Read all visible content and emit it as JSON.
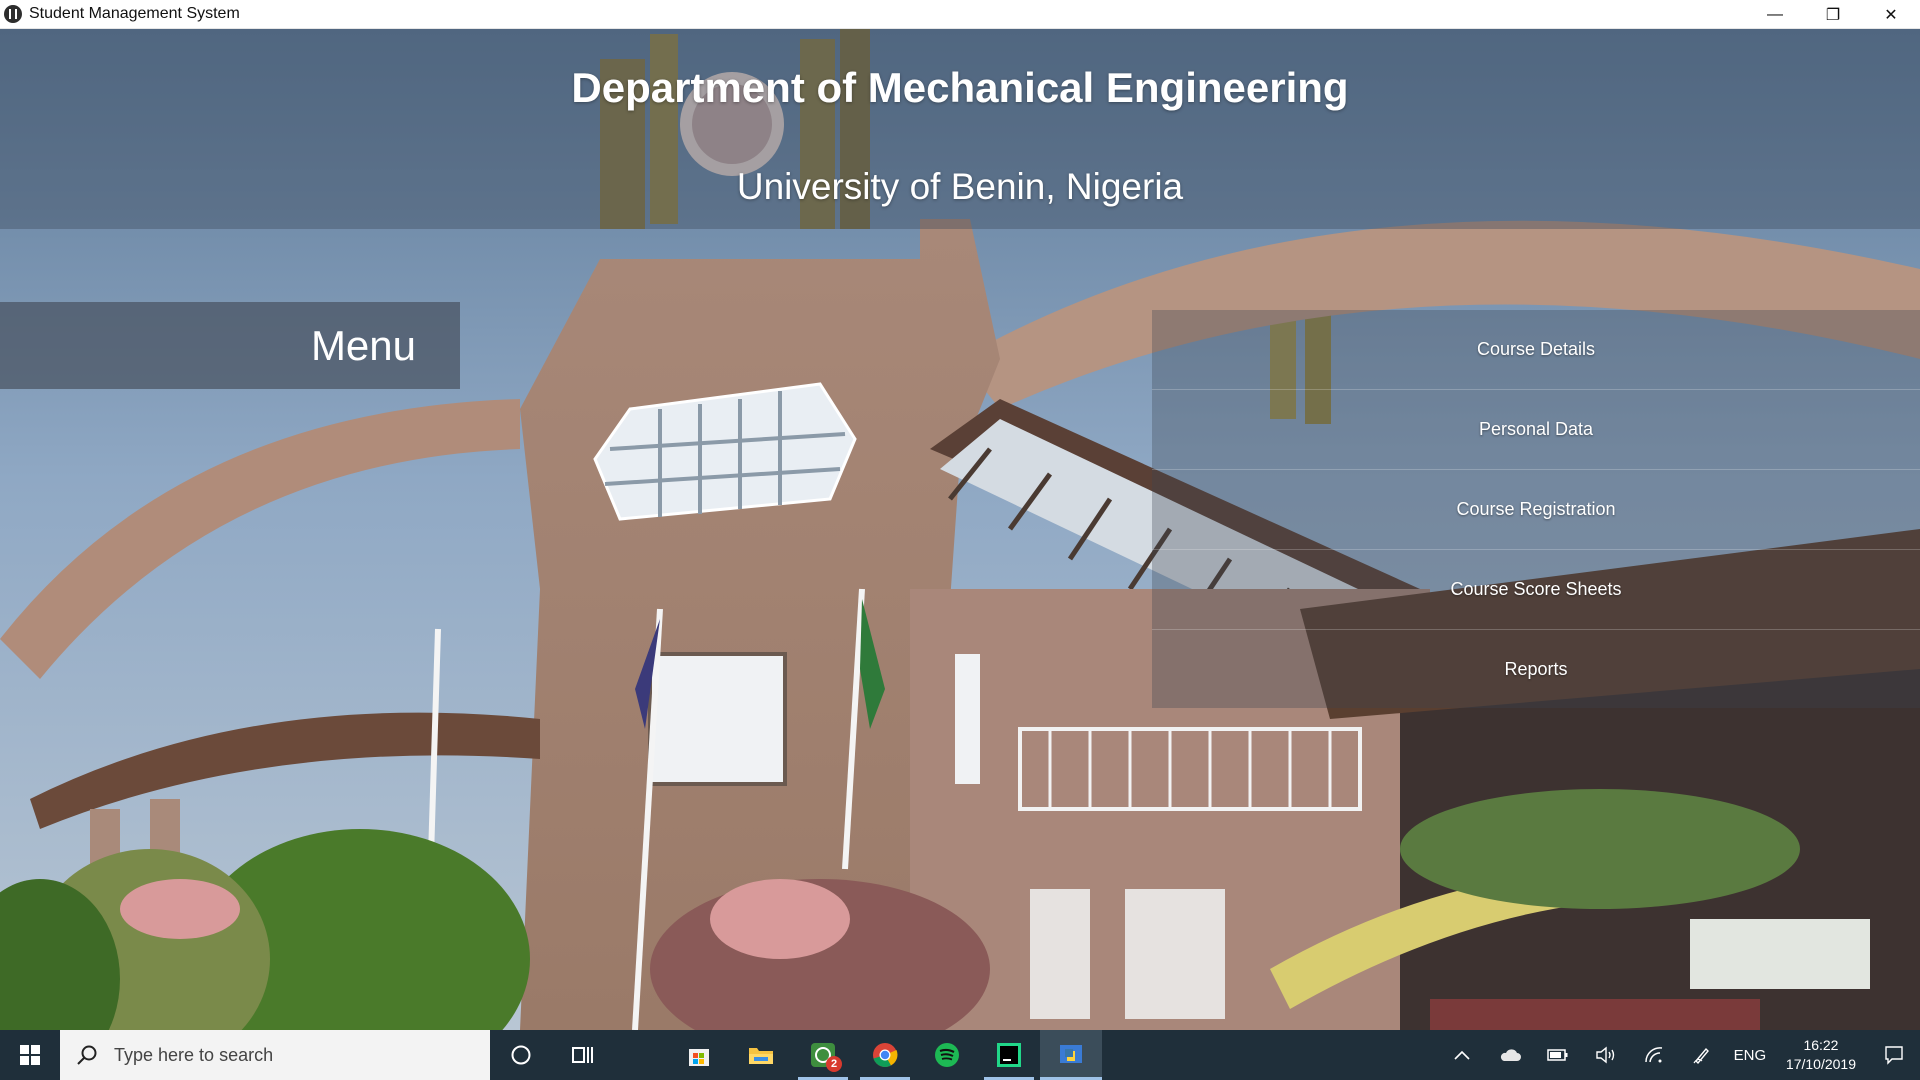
{
  "window": {
    "title": "Student Management System",
    "controls": {
      "minimize": "—",
      "restore": "❐",
      "close": "✕"
    }
  },
  "header": {
    "title": "Department of Mechanical Engineering",
    "subtitle": "University of Benin, Nigeria"
  },
  "menu": {
    "label": "Menu",
    "items": [
      {
        "label": "Course Details"
      },
      {
        "label": "Personal Data"
      },
      {
        "label": "Course Registration"
      },
      {
        "label": "Course Score Sheets"
      },
      {
        "label": "Reports"
      }
    ]
  },
  "taskbar": {
    "search_placeholder": "Type here to search",
    "pinned": [
      "cortana-icon",
      "task-view-icon",
      "store-icon",
      "file-explorer-icon",
      "whatsapp-icon",
      "chrome-icon",
      "spotify-icon",
      "pycharm-icon",
      "python-app-icon"
    ],
    "whatsapp_badge": "2",
    "tray": {
      "language": "ENG",
      "time": "16:22",
      "date": "17/10/2019"
    }
  },
  "colors": {
    "taskbar": "#1f2f3a",
    "sky": "#7f9ab8",
    "building": "#b08c7a",
    "foliage": "#4f7a2a"
  }
}
